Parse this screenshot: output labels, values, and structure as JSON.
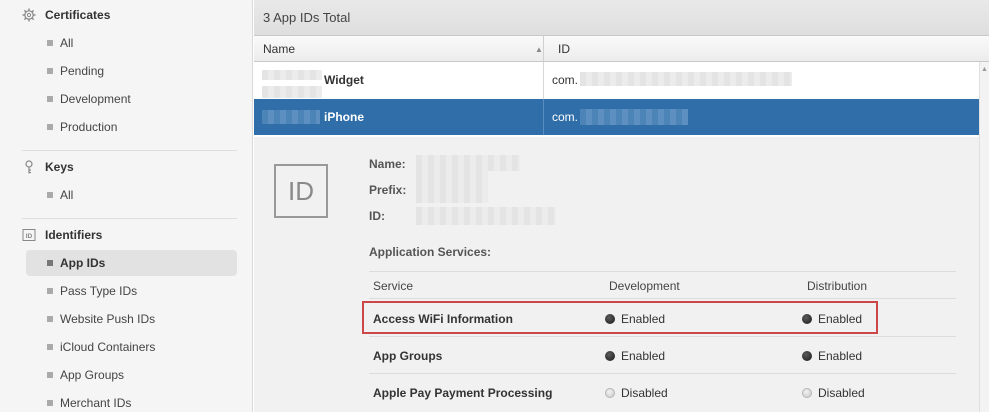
{
  "sidebar": {
    "certificates": {
      "title": "Certificates",
      "icon": "gear-icon",
      "items": [
        "All",
        "Pending",
        "Development",
        "Production"
      ]
    },
    "keys": {
      "title": "Keys",
      "icon": "key-icon",
      "items": [
        "All"
      ]
    },
    "identifiers": {
      "title": "Identifiers",
      "icon": "id-icon",
      "items": [
        "App IDs",
        "Pass Type IDs",
        "Website Push IDs",
        "iCloud Containers",
        "App Groups",
        "Merchant IDs"
      ],
      "active_item": "App IDs"
    }
  },
  "main": {
    "total_label": "3 App IDs Total",
    "columns": {
      "name": "Name",
      "id": "ID"
    },
    "rows": [
      {
        "name": "Widget",
        "id_prefix": "com.",
        "selected": false
      },
      {
        "name": "iPhone",
        "id_prefix": "com.",
        "selected": true
      }
    ]
  },
  "detail": {
    "icon_text": "ID",
    "name_label": "Name:",
    "prefix_label": "Prefix:",
    "id_label": "ID:",
    "application_services_label": "Application Services:",
    "service_columns": {
      "service": "Service",
      "development": "Development",
      "distribution": "Distribution"
    },
    "services": [
      {
        "name": "Access WiFi Information",
        "development": "Enabled",
        "distribution": "Enabled"
      },
      {
        "name": "App Groups",
        "development": "Enabled",
        "distribution": "Enabled"
      },
      {
        "name": "Apple Pay Payment Processing",
        "development": "Disabled",
        "distribution": "Disabled"
      }
    ]
  },
  "colors": {
    "selection": "#2f6ea8",
    "highlight_border": "#cc4848"
  }
}
